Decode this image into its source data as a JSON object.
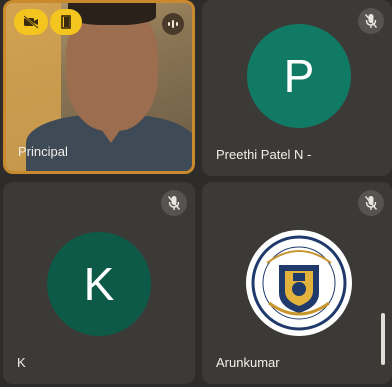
{
  "participants": [
    {
      "name": "Principal",
      "status": "speaking"
    },
    {
      "name": "Preethi Patel N -",
      "avatar_letter": "P",
      "muted": true
    },
    {
      "name": "K",
      "avatar_letter": "K",
      "muted": true
    },
    {
      "name": "Arunkumar",
      "muted": true
    }
  ],
  "colors": {
    "speaking_border": "#c98a2d",
    "avatar_p": "#117a64",
    "avatar_k": "#0e5a48",
    "pill_yellow": "#f3c51e"
  },
  "icons": {
    "mute": "mic-off-icon",
    "camera_off": "camera-off-icon",
    "exit": "door-icon",
    "speaking": "audio-wave-icon"
  }
}
